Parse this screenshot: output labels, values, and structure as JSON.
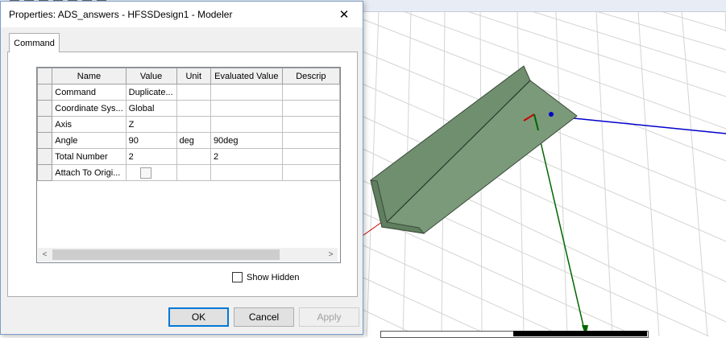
{
  "dialog": {
    "title": "Properties: ADS_answers - HFSSDesign1 - Modeler",
    "close_glyph": "✕",
    "tabs": [
      {
        "label": "Command"
      }
    ],
    "grid": {
      "columns": [
        "Name",
        "Value",
        "Unit",
        "Evaluated Value",
        "Descrip"
      ],
      "rows": [
        {
          "name": "Command",
          "value": "Duplicate...",
          "unit": "",
          "evaluated": ""
        },
        {
          "name": "Coordinate Sys...",
          "value": "Global",
          "unit": "",
          "evaluated": ""
        },
        {
          "name": "Axis",
          "value": "Z",
          "unit": "",
          "evaluated": ""
        },
        {
          "name": "Angle",
          "value": "90",
          "unit": "deg",
          "evaluated": "90deg"
        },
        {
          "name": "Total Number",
          "value": "2",
          "unit": "",
          "evaluated": "2"
        },
        {
          "name": "Attach To Origi...",
          "value": "",
          "unit": "",
          "evaluated": "",
          "checkbox": true,
          "checked": false
        }
      ],
      "scroll_left_glyph": "<",
      "scroll_right_glyph": ">"
    },
    "show_hidden": {
      "label": "Show Hidden",
      "checked": false
    },
    "buttons": {
      "ok": "OK",
      "cancel": "Cancel",
      "apply": "Apply"
    }
  },
  "viewport": {
    "background": "#ffffff",
    "grid_color": "#d0d0d0",
    "shape_fill": "#6f8f6f",
    "shape_edge": "#3a4a3a",
    "axis_x_color": "#cc0000",
    "axis_y_color": "#006600",
    "axis_z_color": "#0000cc"
  }
}
